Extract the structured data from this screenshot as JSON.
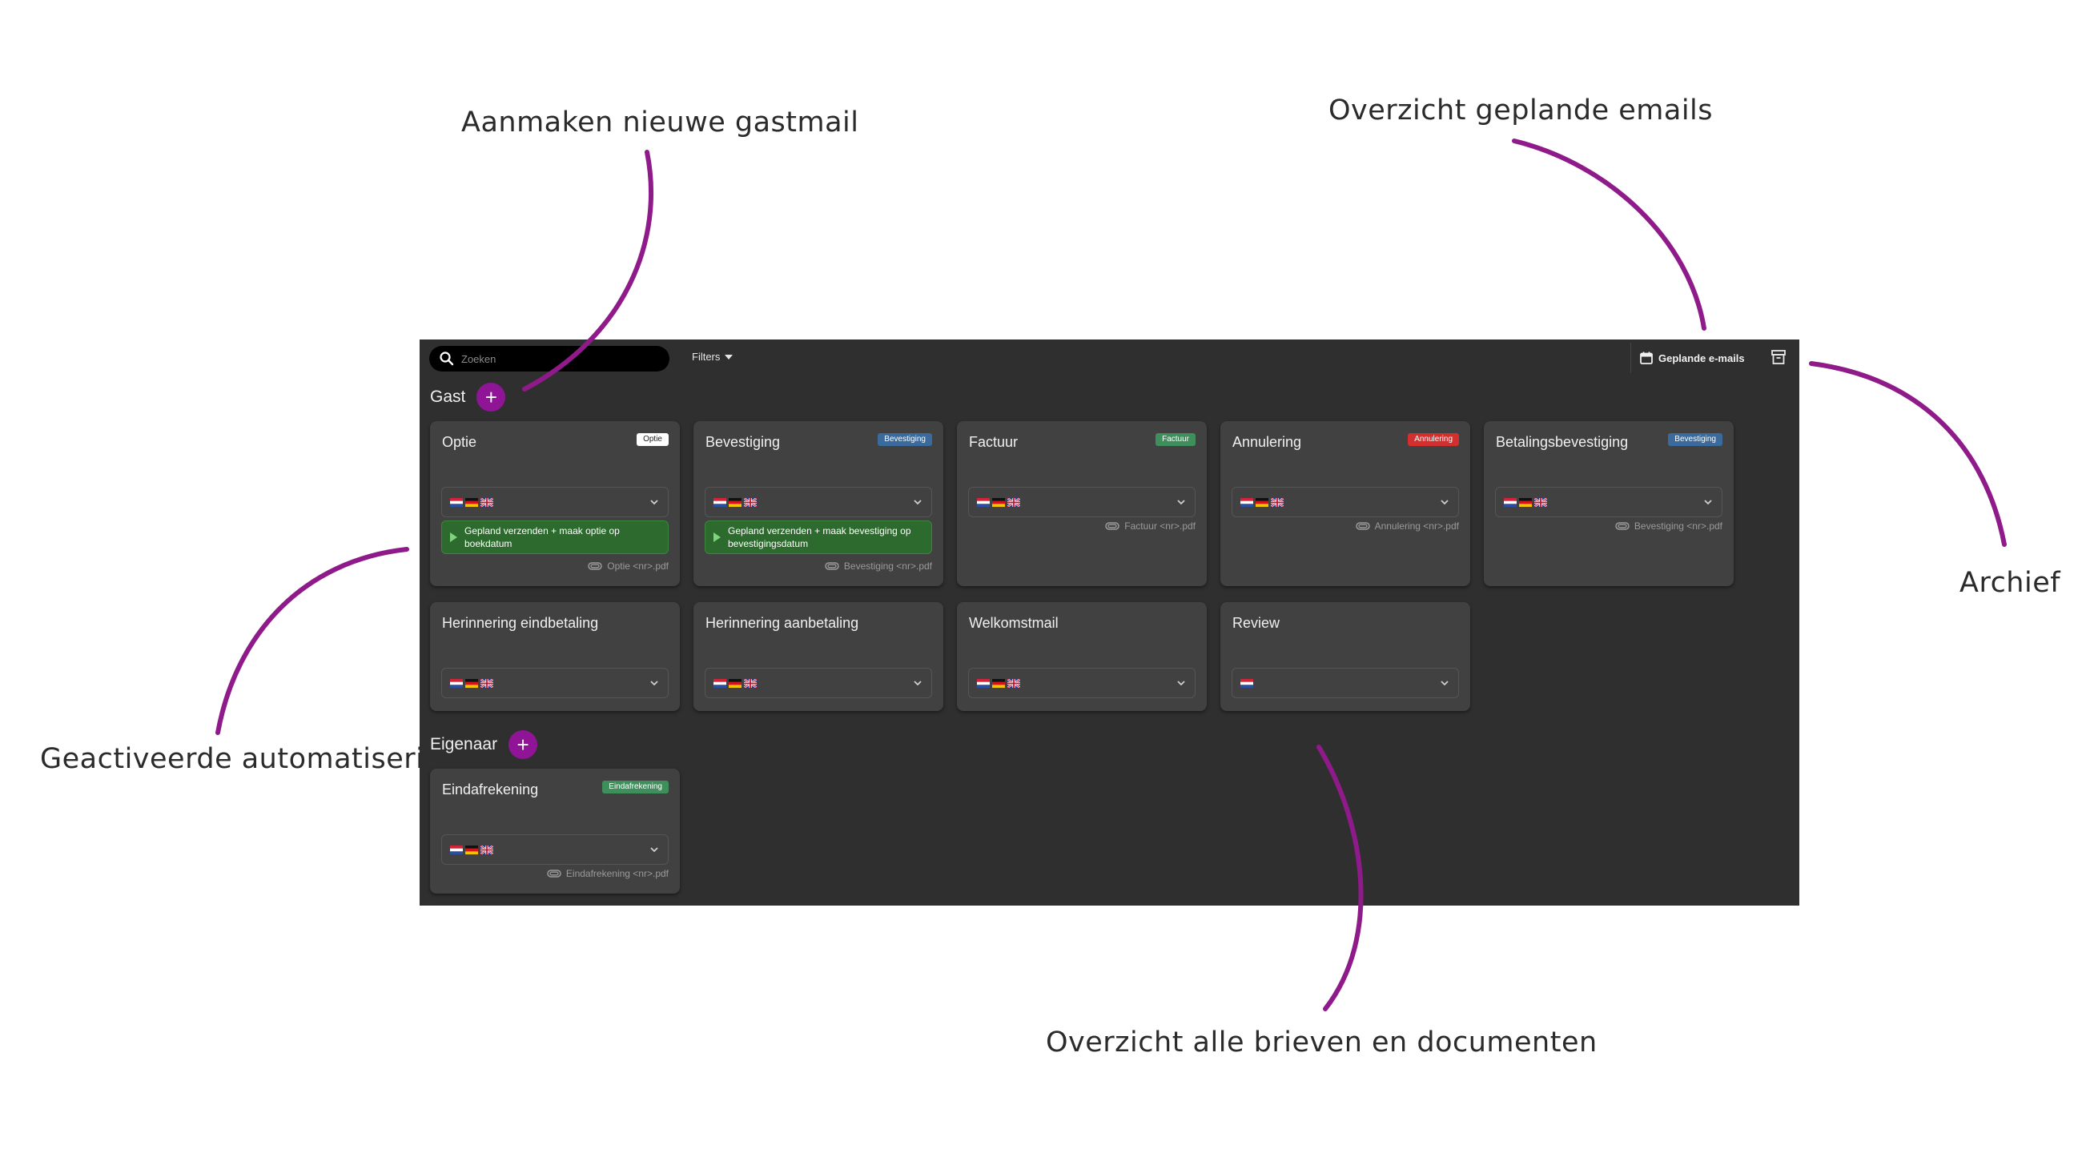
{
  "annotations": {
    "new_guest_mail": "Aanmaken nieuwe gastmail",
    "scheduled_emails": "Overzicht geplande emails",
    "archive": "Archief",
    "activated_automation": "Geactiveerde automatisering",
    "all_letters": "Overzicht alle brieven en documenten"
  },
  "colors": {
    "accent": "#8f1596",
    "background": "#2f2f2f",
    "card": "#414141"
  },
  "toolbar": {
    "search_placeholder": "Zoeken",
    "filters_label": "Filters",
    "scheduled_label": "Geplande e-mails",
    "archive_icon": "archive-icon"
  },
  "sections": {
    "guest": {
      "label": "Gast"
    },
    "owner": {
      "label": "Eigenaar"
    }
  },
  "cards": [
    {
      "title": "Optie",
      "badge": "Optie",
      "badge_color": "#ffffff",
      "badge_text_color": "#222222",
      "flags": [
        "nl",
        "de",
        "gb"
      ],
      "automation": "Gepland verzenden + maak optie op boekdatum",
      "attachment": "Optie <nr>.pdf"
    },
    {
      "title": "Bevestiging",
      "badge": "Bevestiging",
      "badge_color": "#3a6b9c",
      "badge_text_color": "#ffffff",
      "flags": [
        "nl",
        "de",
        "gb"
      ],
      "automation": "Gepland verzenden + maak bevestiging op bevestigingsdatum",
      "attachment": "Bevestiging <nr>.pdf"
    },
    {
      "title": "Factuur",
      "badge": "Factuur",
      "badge_color": "#3f8f5c",
      "badge_text_color": "#ffffff",
      "flags": [
        "nl",
        "de",
        "gb"
      ],
      "attachment": "Factuur <nr>.pdf"
    },
    {
      "title": "Annulering",
      "badge": "Annulering",
      "badge_color": "#d32f2f",
      "badge_text_color": "#ffffff",
      "flags": [
        "nl",
        "de",
        "gb"
      ],
      "attachment": "Annulering <nr>.pdf"
    },
    {
      "title": "Betalingsbevestiging",
      "badge": "Bevestiging",
      "badge_color": "#3a6b9c",
      "badge_text_color": "#ffffff",
      "flags": [
        "nl",
        "de",
        "gb"
      ],
      "attachment": "Bevestiging <nr>.pdf"
    },
    {
      "title": "Herinnering eindbetaling",
      "flags": [
        "nl",
        "de",
        "gb"
      ]
    },
    {
      "title": "Herinnering aanbetaling",
      "flags": [
        "nl",
        "de",
        "gb"
      ]
    },
    {
      "title": "Welkomstmail",
      "flags": [
        "nl",
        "de",
        "gb"
      ]
    },
    {
      "title": "Review",
      "flags": [
        "nl"
      ]
    },
    {
      "title": "Eindafrekening",
      "badge": "Eindafrekening",
      "badge_color": "#3f8f5c",
      "badge_text_color": "#ffffff",
      "flags": [
        "nl",
        "de",
        "gb"
      ],
      "attachment": "Eindafrekening <nr>.pdf"
    }
  ]
}
